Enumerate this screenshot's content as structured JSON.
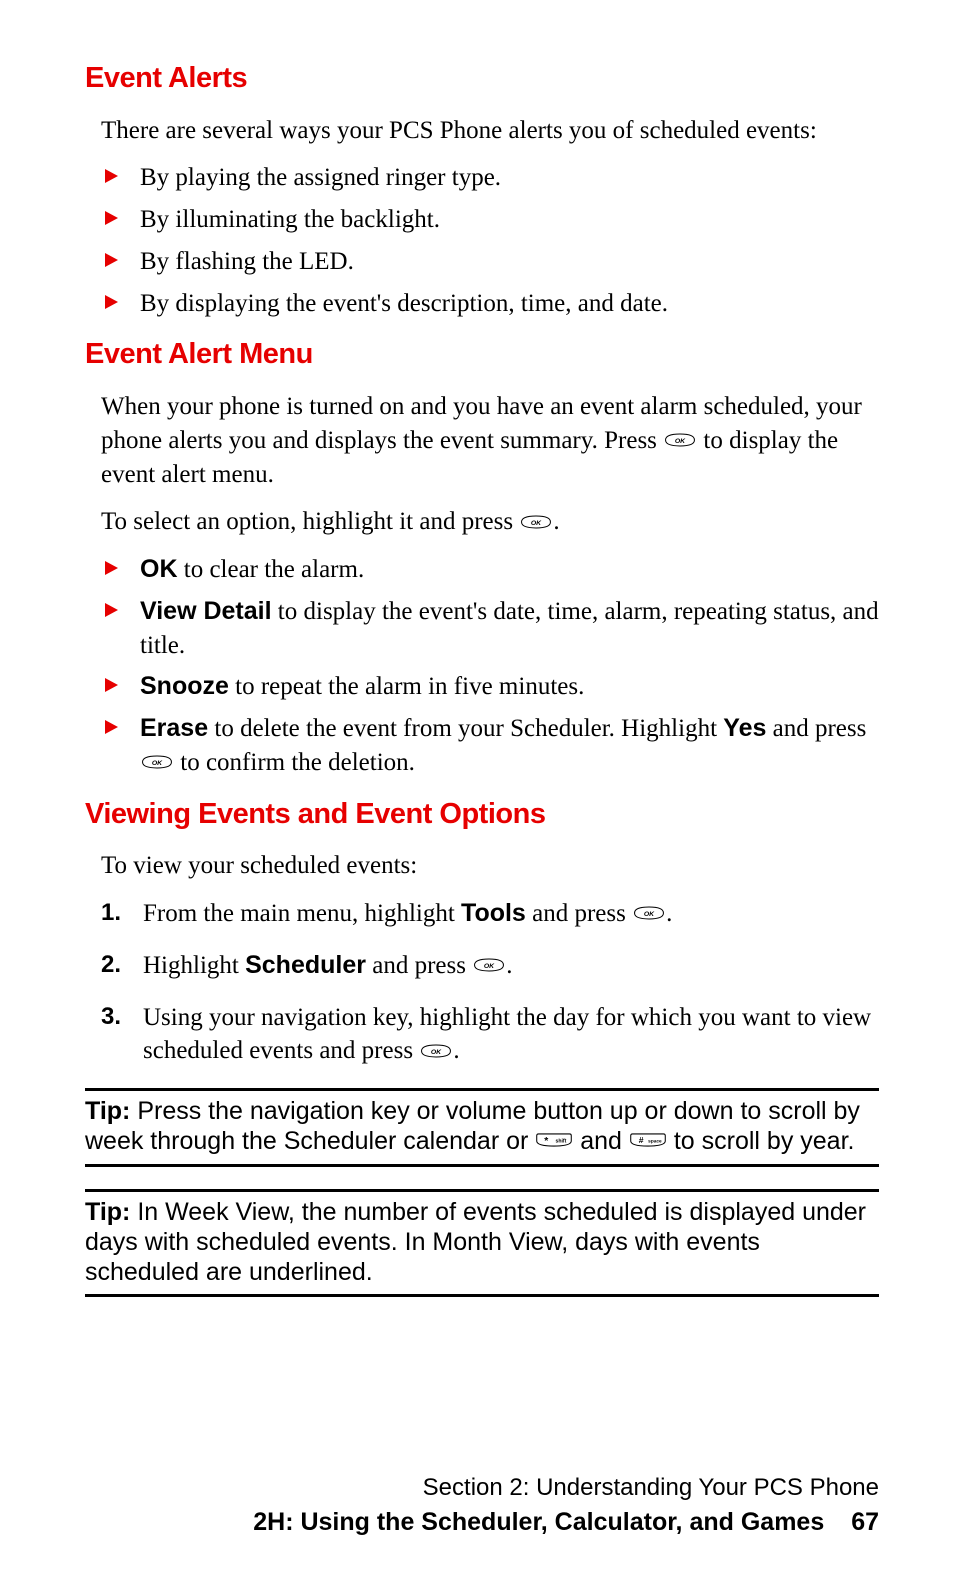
{
  "sections": {
    "event_alerts": {
      "heading": "Event Alerts",
      "intro": "There are several ways your PCS Phone alerts you of scheduled events:",
      "items": [
        "By playing the assigned ringer type.",
        "By illuminating the backlight.",
        "By flashing the LED.",
        "By displaying the event's description, time, and date."
      ]
    },
    "event_alert_menu": {
      "heading": "Event Alert Menu",
      "para1_a": "When your phone is turned on and you have an event alarm scheduled, your phone alerts you and displays the event summary. Press ",
      "para1_b": " to display the event alert menu.",
      "para2_a": "To select an option, highlight it and press ",
      "para2_b": ".",
      "items": [
        {
          "bold": "OK",
          "rest": " to clear the alarm."
        },
        {
          "bold": "View Detail",
          "rest": " to display the event's date, time, alarm, repeating status, and title."
        },
        {
          "bold": "Snooze",
          "rest": " to repeat the alarm in five minutes."
        },
        {
          "bold": "Erase",
          "rest_a": " to delete the event from your Scheduler. Highlight ",
          "bold2": "Yes",
          "rest_b": " and press ",
          "rest_c": " to confirm the deletion."
        }
      ]
    },
    "viewing": {
      "heading": "Viewing Events and Event Options",
      "intro": "To view your scheduled events:",
      "steps": [
        {
          "a": "From the main menu, highlight ",
          "bold": "Tools",
          "b": " and press ",
          "c": "."
        },
        {
          "a": "Highlight ",
          "bold": "Scheduler",
          "b": " and press ",
          "c": "."
        },
        {
          "a": "Using your navigation key, highlight the day for which you want to view scheduled events and press ",
          "c": "."
        }
      ]
    },
    "tip1": {
      "label": "Tip:",
      "a": " Press the navigation key  or volume button up or down to scroll by week through the Scheduler calendar or ",
      "b": " and ",
      "c": " to scroll by year."
    },
    "tip2": {
      "label": "Tip:",
      "text": " In Week View, the number of events scheduled is displayed under days with scheduled events. In Month View, days with events scheduled are underlined."
    }
  },
  "footer": {
    "line1": "Section 2: Understanding Your PCS Phone",
    "line2": "2H: Using the Scheduler, Calculator, and Games",
    "page": "67"
  },
  "icons": {
    "ok": "OK"
  }
}
